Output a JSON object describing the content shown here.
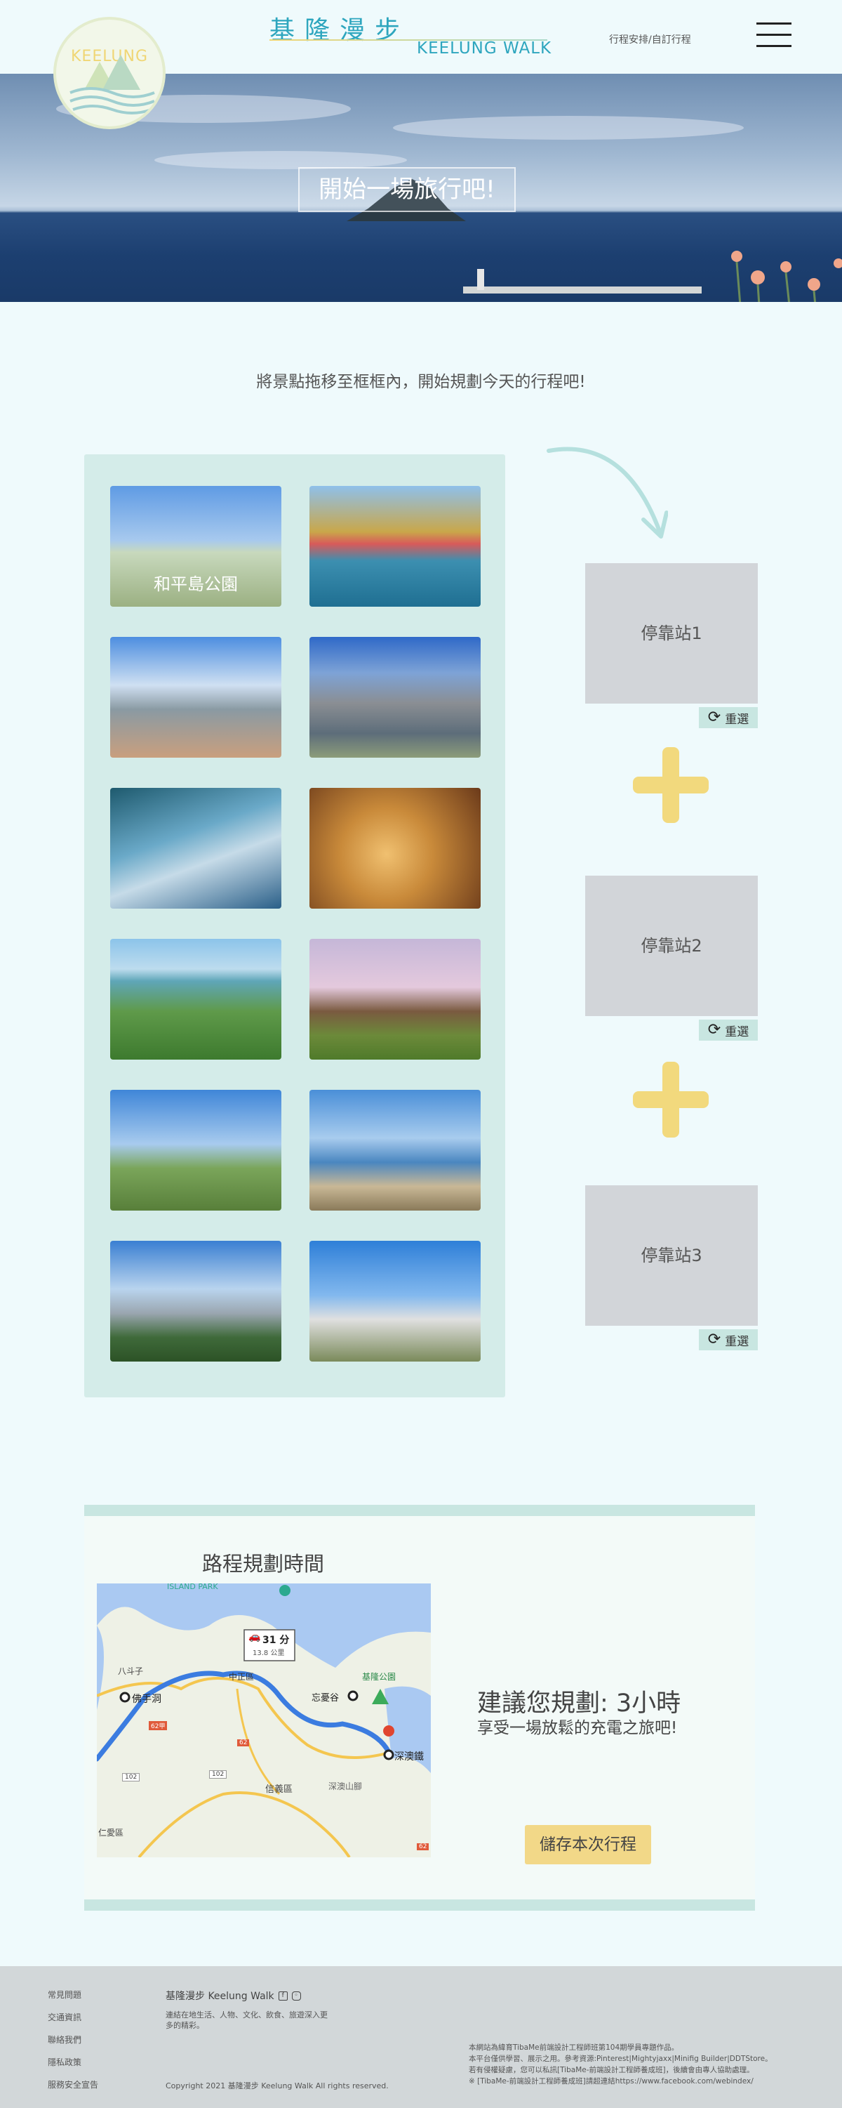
{
  "header": {
    "logo_text": "KEELUNG",
    "brand_zh": "基隆漫步",
    "brand_en": "KEELUNG WALK",
    "nav_link": "行程安排/自訂行程"
  },
  "hero": {
    "button": "開始一場旅行吧!"
  },
  "instruction": "將景點拖移至框框內，開始規劃今天的行程吧!",
  "gallery": {
    "items": [
      {
        "caption": "和平島公園"
      },
      {
        "caption": ""
      },
      {
        "caption": ""
      },
      {
        "caption": ""
      },
      {
        "caption": ""
      },
      {
        "caption": ""
      },
      {
        "caption": ""
      },
      {
        "caption": ""
      },
      {
        "caption": ""
      },
      {
        "caption": ""
      },
      {
        "caption": ""
      },
      {
        "caption": ""
      }
    ]
  },
  "stops": [
    {
      "label": "停靠站1",
      "reset": "重選"
    },
    {
      "label": "停靠站2",
      "reset": "重選"
    },
    {
      "label": "停靠站3",
      "reset": "重選"
    }
  ],
  "route": {
    "title": "路程規劃時間",
    "map": {
      "duration": "31 分",
      "distance": "13.8 公里",
      "labels": [
        "ISLAND PARK",
        "佛手洞",
        "中正區",
        "忘憂谷",
        "基隆公園",
        "深澳鐵",
        "深澳山腳",
        "信義區",
        "仁愛區",
        "八斗子"
      ],
      "road_badges": [
        "62甲",
        "102",
        "102",
        "62",
        "62"
      ]
    },
    "suggestion": "建議您規劃: 3小時",
    "suggestion_sub": "享受一場放鬆的充電之旅吧!",
    "save_button": "儲存本次行程"
  },
  "footer": {
    "links": [
      "常見問題",
      "交通資訊",
      "聯絡我們",
      "隱私政策",
      "服務安全宣告"
    ],
    "brand": "基隆漫步 Keelung Walk",
    "social_icons": [
      "facebook-icon",
      "instagram-icon"
    ],
    "desc": "連結在地生活、人物、文化、飲食、旅遊深入更多的精彩。",
    "copyright": "Copyright  2021 基隆漫步 Keelung Walk All rights reserved.",
    "notice": [
      "本網站為緯育TibaMe前端設計工程師班第104期學員專題作品。",
      "本平台僅供學習、展示之用。參考資源:Pinterest|Mightyjaxx|Minifig Builder|DDTStore。",
      "若有侵權疑慮，您可以私訊[TibaMe-前端設計工程師養成班]，後續會由專人協助處理。",
      "※ [TibaMe-前端設計工程師養成班]請超連結https://www.facebook.com/webindex/"
    ]
  },
  "colors": {
    "accent_teal": "#2ea6be",
    "accent_yellow": "#f2d97d",
    "panel_mint": "#d4ece9",
    "stop_gray": "#d2d5d9"
  }
}
